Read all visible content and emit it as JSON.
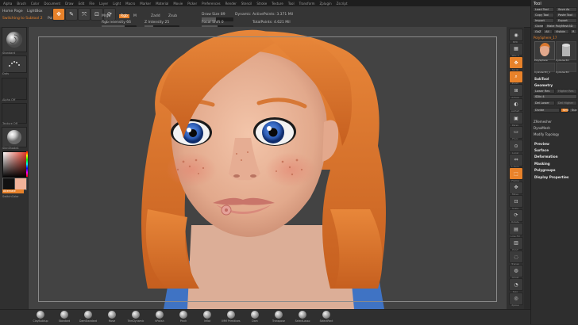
{
  "menu": [
    "Alpha",
    "Brush",
    "Color",
    "Document",
    "Draw",
    "Edit",
    "File",
    "Layer",
    "Light",
    "Macro",
    "Marker",
    "Material",
    "Movie",
    "Picker",
    "Preferences",
    "Render",
    "Stencil",
    "Stroke",
    "Texture",
    "Tool",
    "Transform",
    "Zplugin",
    "Zscript"
  ],
  "toolbar": {
    "tab_home": "Home Page",
    "tab_lightbox": "LightBox",
    "switching": "Switching to Subtool 2",
    "polysphere": "PolySphere",
    "btn_edit": "Edit",
    "btn_draw": "Draw",
    "btn_move": "Move",
    "btn_scale": "Scale",
    "btn_rotate": "Rotate",
    "mrgb": "Mrgb",
    "rgb": "Rgb",
    "m": "M",
    "zadd": "Zadd",
    "zsub": "Zsub",
    "rgb_intensity": "Rgb Intensity 66",
    "z_intensity": "Z Intensity 25",
    "draw_size": "Draw Size 89",
    "focal_shift": "Focal Shift 0",
    "dynamic": "Dynamic",
    "active_points": "ActivePoints: 3.371 Mil",
    "total_points": "TotalPoints: 4.621 Mil",
    "rgb_intensity_level": 0.66,
    "z_intensity_level": 0.25,
    "draw_size_level": 0.45
  },
  "leftshelf": {
    "brush_label": "Standard",
    "stroke_label": "Dots",
    "alpha_label": "Alpha Off",
    "texture_label": "Texture Off",
    "material_label": "SkinShade4",
    "gradient_label": "Gradient",
    "switch_label": "SwitchColor",
    "alternate_label": "Alternate"
  },
  "rightshelf": {
    "buttons": [
      "BPR",
      "SPix 3",
      "Scroll",
      "Zoom",
      "Actual",
      "AAHalf",
      "Persp",
      "Floor",
      "Local",
      "L.Sym",
      "Frame",
      "Move",
      "Scale",
      "Rotate",
      "Line Fill",
      "PolyF",
      "Transp",
      "Ghost",
      "Solo",
      "Xpose"
    ]
  },
  "toolpanel": {
    "title": "Tool",
    "load_tool": "Load Tool",
    "save_as": "Save As",
    "copy_tool": "Copy Tool",
    "paste_tool": "Paste Tool",
    "import": "Import",
    "export": "Export",
    "clone": "Clone",
    "make_polymesh": "Make PolyMesh3D",
    "goz": "GoZ",
    "all": "All",
    "visible": "Visible",
    "r": "R",
    "polysphere_label": "PolySphere_17",
    "thumb1": "PolySphere",
    "thumb2": "Cylinder3D",
    "thumb3": "Cylinder3D_1",
    "thumb4": "Cylinder3D",
    "subtool": "SubTool",
    "geometry": "Geometry",
    "lower_res": "Lower Res",
    "higher_res": "Higher Res",
    "sdiv": "SDiv 4",
    "del_lower": "Del Lower",
    "del_higher": "Del Higher",
    "divide": "Divide",
    "smt": "Smt",
    "suv": "Suv",
    "zremesher": "ZRemesher",
    "dynamesh": "DynaMesh",
    "modify_topology": "Modify Topology",
    "preview": "Preview",
    "surface": "Surface",
    "deformation": "Deformation",
    "masking": "Masking",
    "polygroups": "Polygroups",
    "display_properties": "Display Properties"
  },
  "bottomshelf": {
    "items": [
      "ClayBuildup",
      "Standard",
      "DamStandard",
      "Move",
      "TrimDynamic",
      "hPolish",
      "Pinch",
      "Inflat",
      "IMM Primitives",
      "Dam",
      "Transpose",
      "SelectLasso",
      "SelectRect"
    ]
  },
  "colors": {
    "accent": "#e8822a",
    "canvas_bg": "#434343",
    "hair": "#d9772e",
    "skin": "#e8b596",
    "iris": "#2e5fb8",
    "shirt": "#3f73c4"
  }
}
